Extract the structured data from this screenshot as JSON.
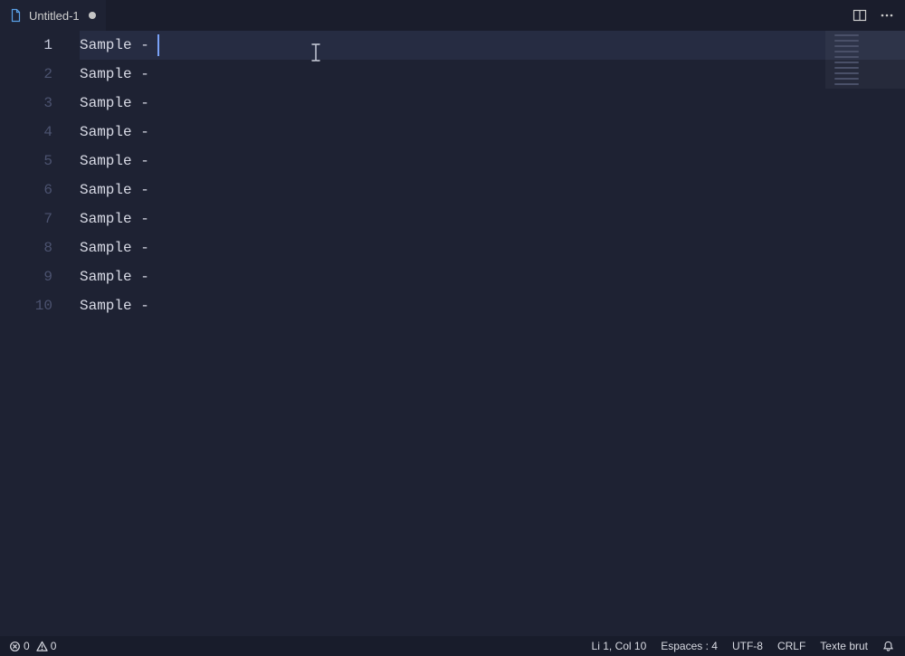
{
  "tab": {
    "filename": "Untitled-1",
    "dirty": true
  },
  "editor": {
    "active_line": 1,
    "caret_col": 10,
    "lines": [
      "Sample - ",
      "Sample - ",
      "Sample - ",
      "Sample - ",
      "Sample - ",
      "Sample - ",
      "Sample - ",
      "Sample - ",
      "Sample - ",
      "Sample - "
    ]
  },
  "status": {
    "errors": "0",
    "warnings": "0",
    "cursor": "Li 1, Col 10",
    "indent": "Espaces : 4",
    "encoding": "UTF-8",
    "eol": "CRLF",
    "language": "Texte brut"
  }
}
